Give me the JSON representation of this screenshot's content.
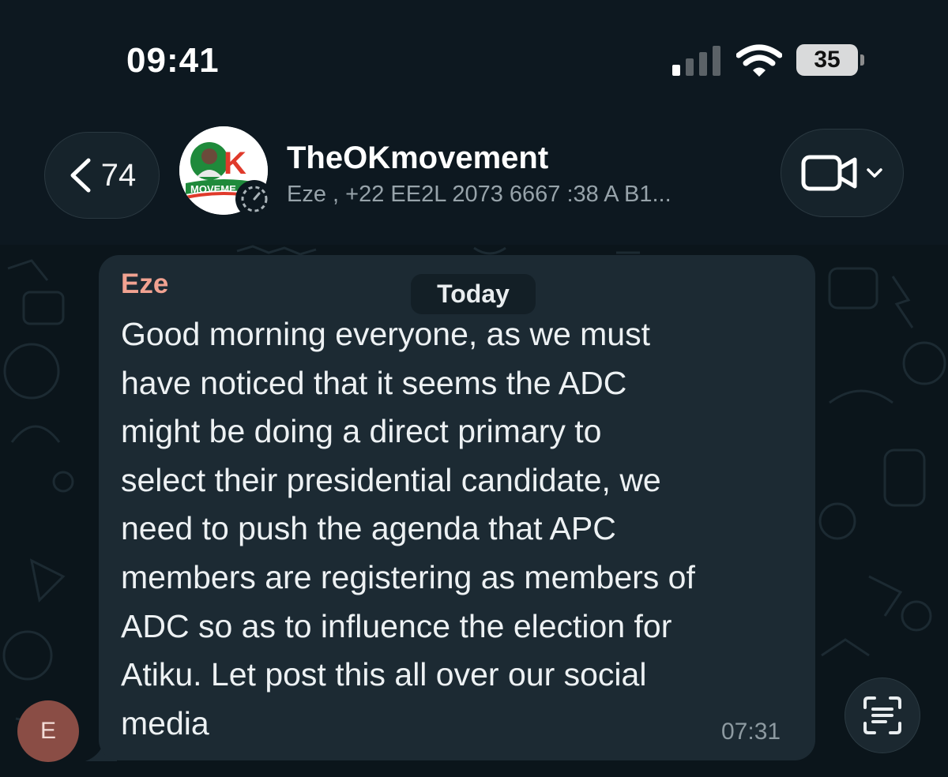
{
  "status_bar": {
    "time": "09:41",
    "battery": "35"
  },
  "header": {
    "back_count": "74",
    "group_name": "TheOKmovement",
    "members": "Eze , +22 EE2L 2073 6667 :38 A B1...",
    "avatar_logo_text": "OK",
    "avatar_logo_sub": "MOVEME"
  },
  "chat": {
    "date_pill": "Today",
    "message": {
      "sender": "Eze",
      "sender_initial": "E",
      "text": "Good morning everyone, as we must\nhave noticed that it seems the ADC\nmight be doing a direct primary to\nselect their presidential candidate, we\nneed to push the agenda that APC\nmembers are registering as members of\nADC so as to influence the election for\nAtiku. Let post this all over our social\nmedia",
      "time": "07:31"
    }
  },
  "icons": {
    "back": "chevron-left-icon",
    "video": "video-camera-icon",
    "dropdown": "chevron-down-icon",
    "scan": "scan-text-icon",
    "signal": "cellular-signal-icon",
    "wifi": "wifi-icon",
    "battery": "battery-icon"
  },
  "colors": {
    "background": "#0b1419",
    "bubble": "#1c2a33",
    "sender_name": "#f1a291",
    "avatar_initial_bg": "#8a4d45",
    "logo_red": "#e03a2b",
    "logo_green": "#1f8a3b"
  }
}
